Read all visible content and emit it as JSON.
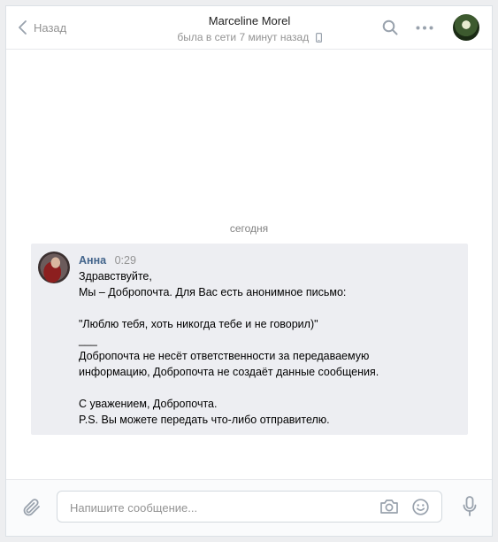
{
  "header": {
    "back_label": "Назад",
    "peer_name": "Marceline Morel",
    "peer_status": "была в сети 7 минут назад"
  },
  "chat": {
    "date_separator": "сегодня",
    "message": {
      "author": "Анна",
      "time": "0:29",
      "lines": [
        "Здравствуйте,",
        "Мы – Добропочта. Для Вас есть анонимное письмо:",
        "",
        "\"Люблю тебя, хоть никогда тебе и не говорил)\"",
        "___",
        "Добропочта не несёт ответственности за передаваемую",
        "информацию, Добропочта не создаёт данные сообщения.",
        "",
        "С уважением, Добропочта.",
        "P.S. Вы можете передать что-либо отправителю."
      ]
    }
  },
  "composer": {
    "placeholder": "Напишите сообщение...",
    "value": ""
  },
  "colors": {
    "accent": "#42648b",
    "message_bg": "#edeef2",
    "icon_gray": "#99a2ad"
  }
}
